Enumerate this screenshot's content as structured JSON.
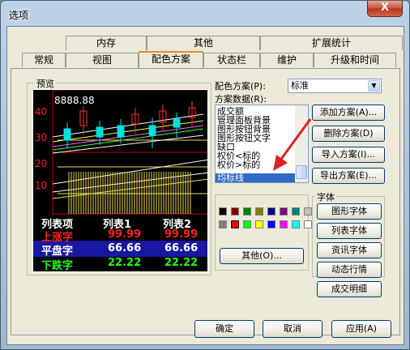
{
  "window": {
    "title": "选项",
    "close_glyph": "X"
  },
  "tabs_row_back": [
    {
      "label": "内存"
    },
    {
      "label": "其他"
    },
    {
      "label": "扩展统计"
    }
  ],
  "tabs_row_front": [
    {
      "label": "常规"
    },
    {
      "label": "视图"
    },
    {
      "label": "配色方案"
    },
    {
      "label": "状态栏"
    },
    {
      "label": "维护"
    },
    {
      "label": "升级和时间"
    }
  ],
  "preview": {
    "group_label": "预览",
    "price_label": "8888.88",
    "axis_labels": [
      "40",
      "30",
      "20",
      "10"
    ],
    "table_header": [
      "列表项",
      "列表1",
      "列表2"
    ],
    "rows": [
      {
        "label": "上涨字",
        "v1": "99.99",
        "v2": "99.99",
        "color": "#ff2020"
      },
      {
        "label": "平盘字",
        "v1": "66.66",
        "v2": "66.66",
        "color": "#ffffff"
      },
      {
        "label": "下跌字",
        "v1": "22.22",
        "v2": "22.22",
        "color": "#20ff20"
      }
    ]
  },
  "scheme": {
    "label": "配色方案(P):",
    "value": "标准",
    "data_label": "方案数据(R):",
    "items": [
      "成交额",
      "管理面板背景",
      "图形按钮背景",
      "图形按钮文字",
      "缺口",
      "权价<标的",
      "权价>标的",
      "均标线"
    ],
    "selected_index": 7
  },
  "scheme_buttons": [
    {
      "label": "添加方案(A)..."
    },
    {
      "label": "删除方案(D)"
    },
    {
      "label": "导入方案(I)..."
    },
    {
      "label": "导出方案(E)..."
    }
  ],
  "palette": {
    "colors": [
      "#000000",
      "#800000",
      "#008000",
      "#808000",
      "#000080",
      "#800080",
      "#008080",
      "#c0c0c0",
      "#808080",
      "#ff0000",
      "#00ff00",
      "#ffff00",
      "#0000ff",
      "#ff00ff",
      "#00ffff",
      "#ffffff"
    ],
    "selected_color": "#ff0000",
    "other_button": "其他(O)..."
  },
  "font": {
    "group_label": "字体",
    "buttons": [
      "图形字体",
      "列表字体",
      "资讯字体",
      "动态行情",
      "成交明细"
    ]
  },
  "footer": {
    "ok": "确定",
    "cancel": "取消",
    "apply": "应用(A)"
  }
}
